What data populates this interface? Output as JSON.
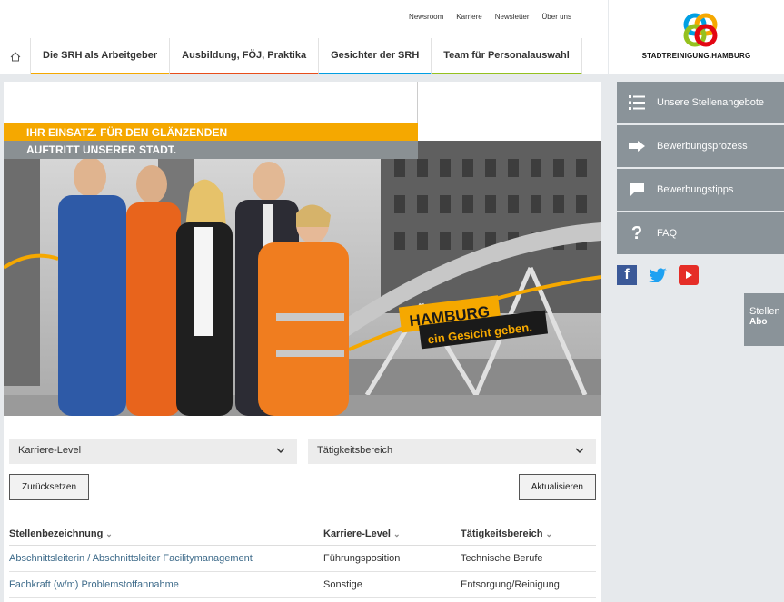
{
  "top_links": [
    "Newsroom",
    "Karriere",
    "Newsletter",
    "Über uns"
  ],
  "nav": [
    {
      "label": "Die SRH als Arbeitgeber",
      "color": "#f5a800"
    },
    {
      "label": "Ausbildung, FÖJ, Praktika",
      "color": "#e84e1b"
    },
    {
      "label": "Gesichter der SRH",
      "color": "#009fe3"
    },
    {
      "label": "Team für Personalauswahl",
      "color": "#95c11f"
    }
  ],
  "logo": {
    "text": "STADTREINIGUNG.HAMBURG"
  },
  "hero": {
    "line1": "IHR EINSATZ. FÜR DEN GLÄNZENDEN",
    "line2": "AUFTRITT UNSERER STADT.",
    "sign1": "HAMBURG",
    "sign2": "ein Gesicht geben."
  },
  "filters": {
    "level": "Karriere-Level",
    "area": "Tätigkeitsbereich"
  },
  "buttons": {
    "reset": "Zurücksetzen",
    "update": "Aktualisieren"
  },
  "table": {
    "headers": [
      "Stellenbezeichnung",
      "Karriere-Level",
      "Tätigkeitsbereich"
    ],
    "rows": [
      [
        "Abschnittsleiterin / Abschnittsleiter Facilitymanagement",
        "Führungsposition",
        "Technische Berufe"
      ],
      [
        "Fachkraft (w/m) Problemstoffannahme",
        "Sonstige",
        "Entsorgung/Reinigung"
      ]
    ]
  },
  "sidebar": [
    "Unsere Stellenangebote",
    "Bewerbungsprozess",
    "Bewerbungstipps",
    "FAQ"
  ],
  "abo": {
    "line1": "Stellen",
    "line2": "Abo"
  },
  "colors": {
    "accent": "#f5a800",
    "side": "#8a9399",
    "link": "#3e6b8a"
  }
}
